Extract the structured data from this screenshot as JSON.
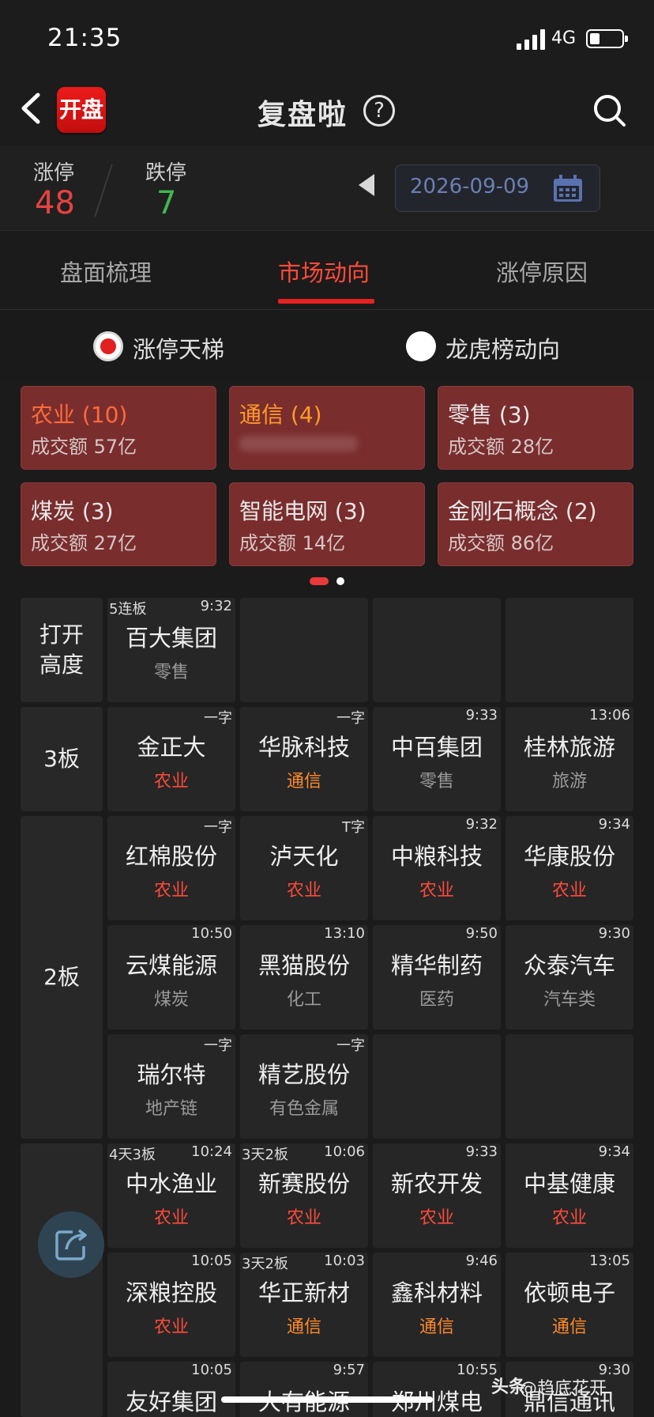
{
  "status_bar": {
    "time": "21:35",
    "network": "4G"
  },
  "header": {
    "back_label": "<",
    "logo_text": "开盘",
    "title": "复盘啦",
    "help_label": "?"
  },
  "summary": {
    "limit_up_label": "涨停",
    "limit_up_value": "48",
    "limit_down_label": "跌停",
    "limit_down_value": "7",
    "date": "2026-09-09"
  },
  "tabs": [
    {
      "label": "盘面梳理"
    },
    {
      "label": "市场动向"
    },
    {
      "label": "涨停原因"
    }
  ],
  "radios": [
    {
      "label": "涨停天梯",
      "selected": true
    },
    {
      "label": "龙虎榜动向",
      "selected": false
    }
  ],
  "sectors": [
    {
      "name": "农业 (10)",
      "amount": "成交额 57亿",
      "color": "#ff6a3a"
    },
    {
      "name": "通信 (4)",
      "amount": "",
      "color": "#ff9a2a"
    },
    {
      "name": "零售 (3)",
      "amount": "成交额 28亿",
      "color": "#e8e8e8"
    },
    {
      "name": "煤炭 (3)",
      "amount": "成交额 27亿",
      "color": "#e8e8e8"
    },
    {
      "name": "智能电网 (3)",
      "amount": "成交额 14亿",
      "color": "#e8e8e8"
    },
    {
      "name": "金刚石概念 (2)",
      "amount": "成交额 86亿",
      "color": "#e8e8e8"
    }
  ],
  "ladder": {
    "open_label": "打开\n高度",
    "b3_label": "3板",
    "b2_label": "2板",
    "open": [
      {
        "tag": "5连板",
        "time": "9:32",
        "name": "百大集团",
        "sector": "零售"
      }
    ],
    "b3": [
      {
        "tag": "",
        "time": "一字",
        "name": "金正大",
        "sector": "农业"
      },
      {
        "tag": "",
        "time": "一字",
        "name": "华脉科技",
        "sector": "通信"
      },
      {
        "tag": "",
        "time": "9:33",
        "name": "中百集团",
        "sector": "零售"
      },
      {
        "tag": "",
        "time": "13:06",
        "name": "桂林旅游",
        "sector": "旅游"
      }
    ],
    "b2": [
      {
        "tag": "",
        "time": "一字",
        "name": "红棉股份",
        "sector": "农业"
      },
      {
        "tag": "",
        "time": "T字",
        "name": "泸天化",
        "sector": "农业"
      },
      {
        "tag": "",
        "time": "9:32",
        "name": "中粮科技",
        "sector": "农业"
      },
      {
        "tag": "",
        "time": "9:34",
        "name": "华康股份",
        "sector": "农业"
      },
      {
        "tag": "",
        "time": "10:50",
        "name": "云煤能源",
        "sector": "煤炭"
      },
      {
        "tag": "",
        "time": "13:10",
        "name": "黑猫股份",
        "sector": "化工"
      },
      {
        "tag": "",
        "time": "9:50",
        "name": "精华制药",
        "sector": "医药"
      },
      {
        "tag": "",
        "time": "9:30",
        "name": "众泰汽车",
        "sector": "汽车类"
      },
      {
        "tag": "",
        "time": "一字",
        "name": "瑞尔特",
        "sector": "地产链"
      },
      {
        "tag": "",
        "time": "一字",
        "name": "精艺股份",
        "sector": "有色金属"
      }
    ],
    "b1": [
      {
        "tag": "4天3板",
        "time": "10:24",
        "name": "中水渔业",
        "sector": "农业"
      },
      {
        "tag": "3天2板",
        "time": "10:06",
        "name": "新赛股份",
        "sector": "农业"
      },
      {
        "tag": "",
        "time": "9:33",
        "name": "新农开发",
        "sector": "农业"
      },
      {
        "tag": "",
        "time": "9:34",
        "name": "中基健康",
        "sector": "农业"
      },
      {
        "tag": "",
        "time": "10:05",
        "name": "深粮控股",
        "sector": "农业"
      },
      {
        "tag": "3天2板",
        "time": "10:03",
        "name": "华正新材",
        "sector": "通信"
      },
      {
        "tag": "",
        "time": "9:46",
        "name": "鑫科材料",
        "sector": "通信"
      },
      {
        "tag": "",
        "time": "13:05",
        "name": "依顿电子",
        "sector": "通信"
      },
      {
        "tag": "",
        "time": "10:05",
        "name": "友好集团",
        "sector": ""
      },
      {
        "tag": "",
        "time": "9:57",
        "name": "大有能源",
        "sector": ""
      },
      {
        "tag": "",
        "time": "10:55",
        "name": "郑州煤电",
        "sector": ""
      },
      {
        "tag": "",
        "time": "9:30",
        "name": "鼎信通讯",
        "sector": ""
      }
    ]
  },
  "sector_colors": {
    "农业": "#ff4a3a",
    "通信": "#ff8a2a"
  },
  "watermark": {
    "icon": "头条",
    "text": "@趋底花开"
  }
}
